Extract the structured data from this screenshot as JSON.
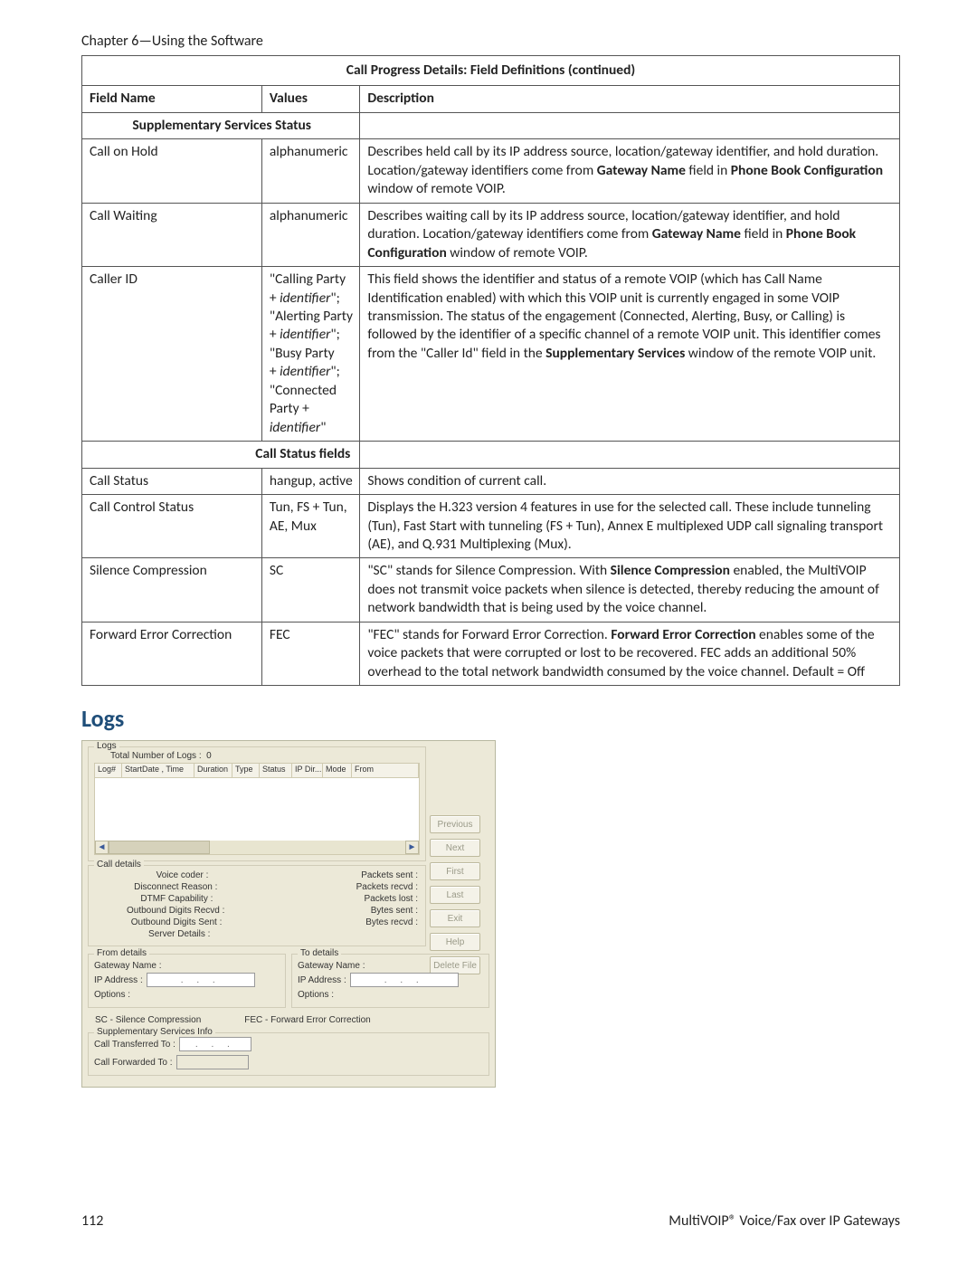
{
  "chapter": "Chapter 6—Using the Software",
  "table": {
    "title": "Call Progress Details: Field Definitions (continued)",
    "headers": {
      "c1": "Field Name",
      "c2": "Values",
      "c3": "Description"
    },
    "section1": "Supplementary Services Status",
    "rows1": [
      {
        "field": "Call on Hold",
        "values": "alphanumeric",
        "desc_pre": "Describes held call by its IP address source, location/gateway identifier, and hold duration. Location/gateway identifiers come from ",
        "b1": "Gateway Name",
        "desc_mid": " field in ",
        "b2": "Phone Book Configuration",
        "desc_post": " window of remote VOIP."
      },
      {
        "field": "Call Waiting",
        "values": "alphanumeric",
        "desc_pre": "Describes waiting call by its IP address source, location/gateway identifier, and hold duration. Location/gateway identifiers come from ",
        "b1": "Gateway Name",
        "desc_mid": " field in ",
        "b2": "Phone Book Configuration",
        "desc_post": " window of remote VOIP."
      }
    ],
    "caller_id": {
      "field": "Caller ID",
      "v1a": "\"Calling Party + ",
      "v1b": "identifier",
      "v1c": "\";",
      "v2a": "\"Alerting Party + ",
      "v2b": "identifier",
      "v2c": "\";",
      "v3a": "\"Busy Party",
      "v3b": "+ ",
      "v3c": "identifier",
      "v3d": "\";",
      "v4a": "\"Connected Party + ",
      "v4b": "identifier",
      "v4c": "\"",
      "desc_pre": "This field shows the identifier and status of a remote VOIP (which has Call Name Identification enabled) with which this VOIP unit is currently engaged in some VOIP transmission. The status of the engagement (Connected, Alerting, Busy, or Calling) is followed by the identifier of a specific channel of a remote VOIP unit. This identifier comes from the \"Caller Id\" field in the ",
      "b1": "Supplementary Services",
      "desc_post": " window of the remote VOIP unit."
    },
    "section2": "Call Status fields",
    "rows2": [
      {
        "field": "Call Status",
        "values": "hangup, active",
        "desc": "Shows condition of current call."
      },
      {
        "field": "Call Control Status",
        "values": "Tun, FS + Tun, AE, Mux",
        "desc": "Displays the H.323 version 4 features in use for the selected call. These include tunneling (Tun), Fast Start with tunneling (FS + Tun), Annex E multiplexed UDP call signaling transport (AE), and Q.931 Multiplexing (Mux)."
      }
    ],
    "sc": {
      "field": "Silence Compression",
      "values": "SC",
      "desc_pre": "\"SC\" stands for Silence Compression. With ",
      "b1": "Silence Compression",
      "desc_post": " enabled, the MultiVOIP does not transmit voice packets when silence is detected, thereby reducing the amount of network bandwidth that is being used by the voice channel."
    },
    "fec": {
      "field": "Forward Error Correction",
      "values": "FEC",
      "desc_pre": "\"FEC\" stands for Forward Error Correction. ",
      "b1": "Forward Error Correction",
      "desc_post": " enables some of the voice packets that were corrupted or lost to be recovered. FEC adds an additional 50% overhead to the total network bandwidth consumed by the voice channel. Default = Off"
    }
  },
  "heading": "Logs",
  "dlg": {
    "legend_logs": "Logs",
    "total_label": "Total Number of Logs :",
    "total_value": "0",
    "cols": {
      "c1": "Log#",
      "c2": "StartDate , Time",
      "c3": "Duration",
      "c4": "Type",
      "c5": "Status",
      "c6": "IP Dir...",
      "c7": "Mode",
      "c8": "From"
    },
    "buttons": {
      "previous": "Previous",
      "next": "Next",
      "first": "First",
      "last": "Last",
      "exit": "Exit",
      "help": "Help",
      "delete": "Delete File"
    },
    "legend_call": "Call details",
    "call_left": {
      "l1": "Voice coder :",
      "l2": "Disconnect Reason :",
      "l3": "DTMF Capability :",
      "l4": "Outbound Digits Recvd :",
      "l5": "Outbound Digits Sent :",
      "l6": "Server Details :"
    },
    "call_right": {
      "r1": "Packets sent :",
      "r2": "Packets recvd :",
      "r3": "Packets lost :",
      "r4": "Bytes sent :",
      "r5": "Bytes recvd :"
    },
    "legend_from": "From details",
    "legend_to": "To details",
    "from": {
      "gw": "Gateway Name :",
      "ip": "IP Address :",
      "opt": "Options :"
    },
    "to": {
      "gw": "Gateway Name :",
      "ip": "IP Address :",
      "opt": "Options :"
    },
    "ip_placeholder": ".   .   .",
    "abbr": {
      "sc": "SC - Silence Compression",
      "fec": "FEC - Forward Error Correction"
    },
    "legend_supp": "Supplementary Services Info",
    "supp": {
      "xfer": "Call Transferred To :",
      "fwd": "Call Forwarded To :"
    }
  },
  "footer": {
    "page": "112",
    "book": "MultiVOIP® Voice/Fax over IP Gateways"
  }
}
